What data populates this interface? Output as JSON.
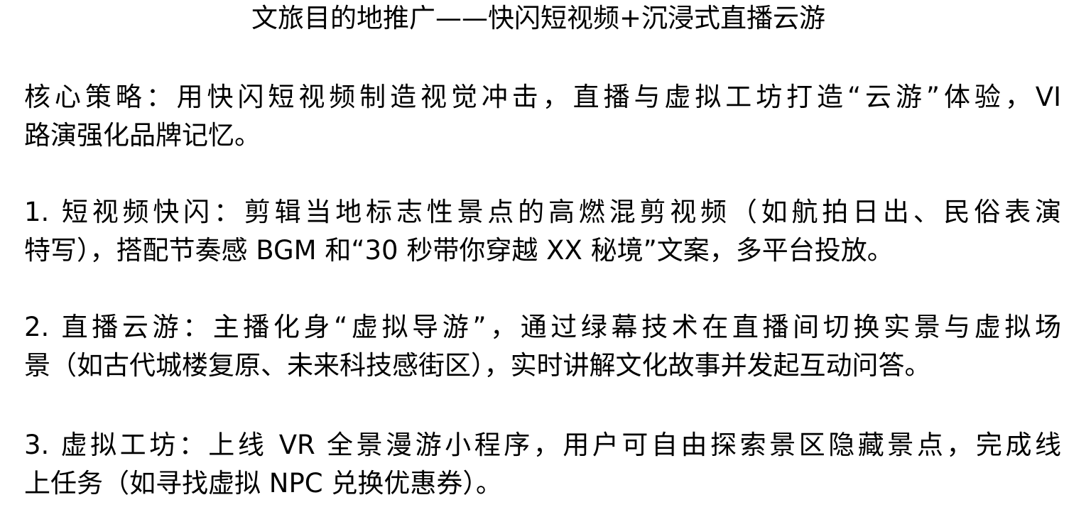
{
  "document": {
    "title": "文旅目的地推广——快闪短视频+沉浸式直播云游",
    "paragraphs": [
      {
        "lines": [
          "核心策略：用快闪短视频制造视觉冲击，直播与虚拟工坊打造“云游”体验，VI",
          "路演强化品牌记忆。"
        ]
      },
      {
        "lines": [
          "1. 短视频快闪：剪辑当地标志性景点的高燃混剪视频（如航拍日出、民俗表演",
          "特写），搭配节奏感 BGM 和“30 秒带你穿越 XX 秘境”文案，多平台投放。"
        ]
      },
      {
        "lines": [
          "2. 直播云游：主播化身“虚拟导游”，通过绿幕技术在直播间切换实景与虚拟场",
          "景（如古代城楼复原、未来科技感街区），实时讲解文化故事并发起互动问答。"
        ]
      },
      {
        "lines": [
          "3. 虚拟工坊：上线 VR 全景漫游小程序，用户可自由探索景区隐藏景点，完成线",
          "上任务（如寻找虚拟 NPC 兑换优惠券）。"
        ]
      }
    ]
  }
}
